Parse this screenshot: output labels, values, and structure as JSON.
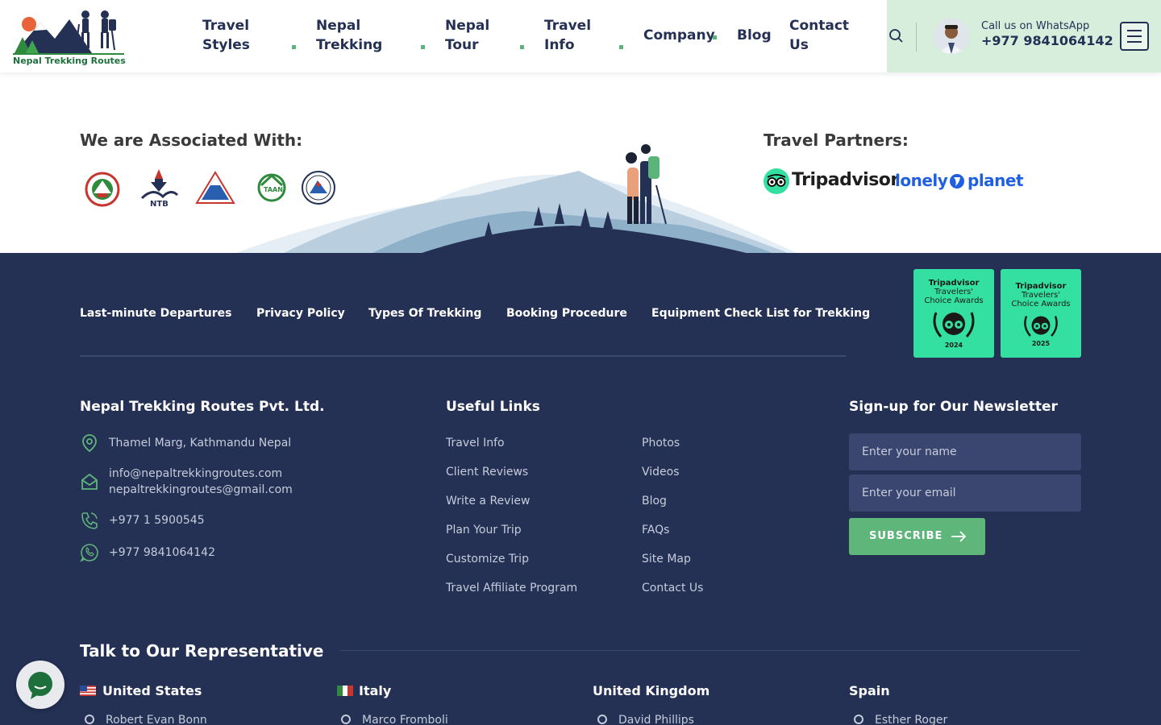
{
  "header": {
    "logo_text": "Nepal Trekking Routes",
    "nav": [
      {
        "label": "Travel Styles"
      },
      {
        "label": "Nepal Trekking"
      },
      {
        "label": "Nepal Tour"
      },
      {
        "label": "Travel Info"
      },
      {
        "label": "Company"
      },
      {
        "label": "Blog"
      },
      {
        "label": "Contact Us"
      }
    ],
    "cta_label": "Call us on WhatsApp",
    "cta_phone": "+977 9841064142"
  },
  "associations": {
    "title": "We are Associated With:",
    "logos": [
      "nepal-government-emblem",
      "nepal-tourism-board",
      "nepal-mountaineering-association",
      "taan",
      "himalayan-rescue-association"
    ]
  },
  "partners": {
    "title": "Travel Partners:",
    "tripadvisor": "Tripadvisor",
    "lonely_planet_a": "lonely",
    "lonely_planet_b": "planet"
  },
  "quick_links": [
    "Last-minute Departures",
    "Privacy Policy",
    "Types Of Trekking",
    "Booking Procedure",
    "Equipment Check List for Trekking"
  ],
  "awards": [
    {
      "line1": "Tripadvisor",
      "line2": "Travelers'",
      "line3": "Choice Awards",
      "year": "2024"
    },
    {
      "line1": "Tripadvisor",
      "line2": "Travelers'",
      "line3": "Choice Awards",
      "year": "2025"
    }
  ],
  "company": {
    "title": "Nepal Trekking Routes Pvt. Ltd.",
    "address": "Thamel Marg, Kathmandu Nepal",
    "email1": "info@nepaltrekkingroutes.com",
    "email2": "nepaltrekkingroutes@gmail.com",
    "phone": "+977 1 5900545",
    "whatsapp": "+977 9841064142"
  },
  "useful_links": {
    "title": "Useful Links",
    "col1": [
      "Travel Info",
      "Client Reviews",
      "Write a Review",
      "Plan Your Trip",
      "Customize Trip",
      "Travel Affiliate Program"
    ],
    "col2": [
      "Photos",
      "Videos",
      "Blog",
      "FAQs",
      "Site Map",
      "Contact Us"
    ]
  },
  "newsletter": {
    "title": "Sign-up for Our Newsletter",
    "name_placeholder": "Enter your name",
    "email_placeholder": "Enter your email",
    "button": "SUBSCRIBE"
  },
  "representatives": {
    "title": "Talk to Our Representative",
    "countries": [
      {
        "country": "United States",
        "name": "Robert Evan Bonn"
      },
      {
        "country": "Italy",
        "name": "Marco Fromboli"
      },
      {
        "country": "United Kingdom",
        "name": "David Phillips"
      },
      {
        "country": "Spain",
        "name": "Esther Roger"
      }
    ]
  },
  "colors": {
    "navy": "#243054",
    "green": "#5fb67b",
    "mint": "#34e0a1",
    "cta_bg": "#d8eedd"
  }
}
